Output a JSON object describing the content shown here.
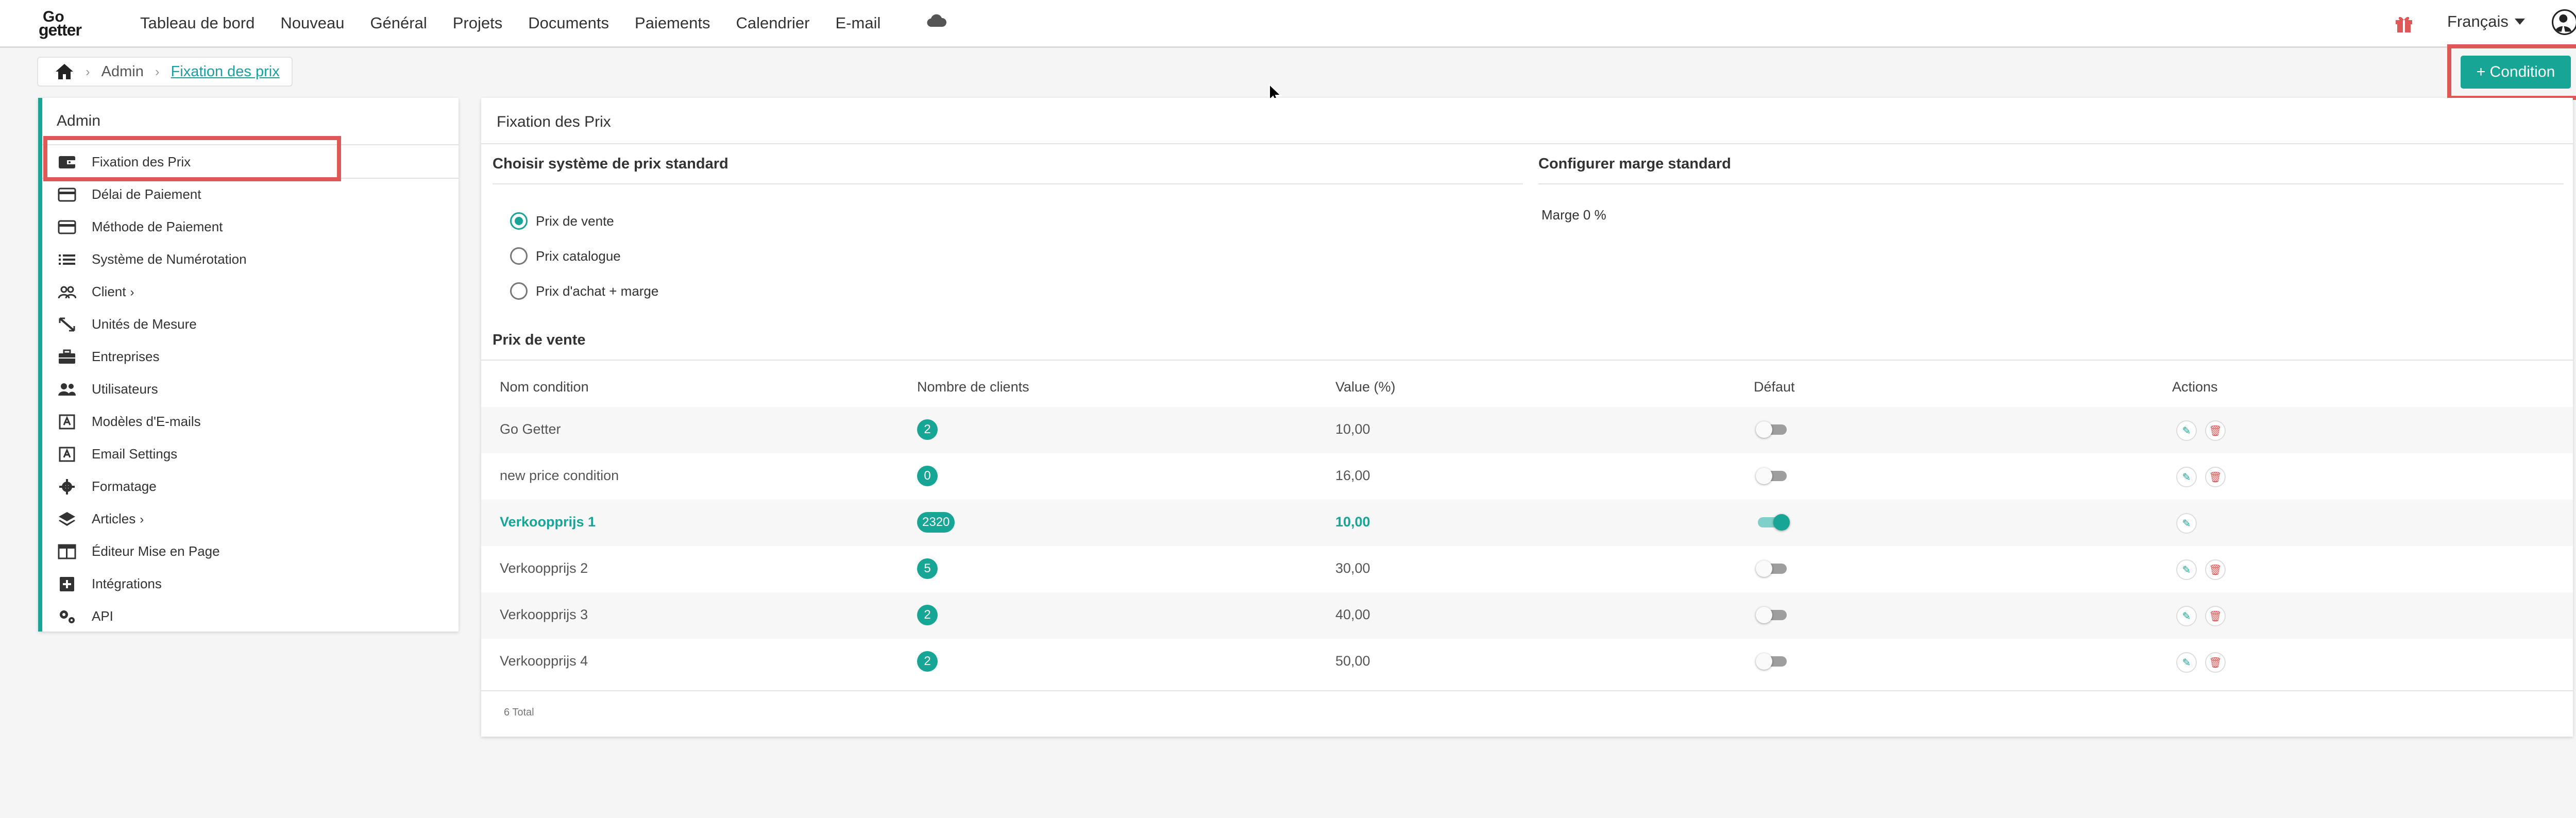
{
  "header": {
    "logo_top": "Go",
    "logo_bottom": "getter",
    "nav": [
      "Tableau de bord",
      "Nouveau",
      "Général",
      "Projets",
      "Documents",
      "Paiements",
      "Calendrier",
      "E-mail"
    ],
    "language": "Français",
    "icons": [
      "cloud-icon",
      "gift-icon",
      "avatar-icon"
    ]
  },
  "breadcrumb": {
    "home_icon": "home-icon",
    "items": [
      "Admin",
      "Fixation des prix"
    ]
  },
  "actions": {
    "condition_button": "+ Condition"
  },
  "sidebar": {
    "title": "Admin",
    "items": [
      {
        "label": "Fixation des Prix",
        "icon": "wallet-icon"
      },
      {
        "label": "Délai de Paiement",
        "icon": "card-icon"
      },
      {
        "label": "Méthode de Paiement",
        "icon": "card-icon"
      },
      {
        "label": "Système de Numérotation",
        "icon": "list-icon"
      },
      {
        "label": "Client",
        "icon": "people-icon",
        "chevron": "›"
      },
      {
        "label": "Unités de Mesure",
        "icon": "ruler-icon"
      },
      {
        "label": "Entreprises",
        "icon": "briefcase-icon"
      },
      {
        "label": "Utilisateurs",
        "icon": "users-icon"
      },
      {
        "label": "Modèles d'E-mails",
        "icon": "template-icon"
      },
      {
        "label": "Email Settings",
        "icon": "template-icon"
      },
      {
        "label": "Formatage",
        "icon": "gear-icon"
      },
      {
        "label": "Articles",
        "icon": "layers-icon",
        "chevron": "›"
      },
      {
        "label": "Éditeur Mise en Page",
        "icon": "layout-icon"
      },
      {
        "label": "Intégrations",
        "icon": "plus-box-icon"
      },
      {
        "label": "API",
        "icon": "gears-icon"
      }
    ]
  },
  "main": {
    "title": "Fixation des Prix",
    "price_system_title": "Choisir système de prix standard",
    "margin_title": "Configurer marge standard",
    "radio_options": [
      "Prix de vente",
      "Prix catalogue",
      "Prix d'achat + marge"
    ],
    "selected_option": "Prix de vente",
    "margin_text": "Marge 0 %",
    "table_title": "Prix de vente",
    "columns": [
      "Nom condition",
      "Nombre de clients",
      "Value (%)",
      "Défaut",
      "Actions"
    ],
    "rows": [
      {
        "name": "Go Getter",
        "clients": "2",
        "value": "10,00",
        "default": false
      },
      {
        "name": "new price condition",
        "clients": "0",
        "value": "16,00",
        "default": false
      },
      {
        "name": "Verkoopprijs 1",
        "clients": "2320",
        "value": "10,00",
        "default": true
      },
      {
        "name": "Verkoopprijs 2",
        "clients": "5",
        "value": "30,00",
        "default": false
      },
      {
        "name": "Verkoopprijs 3",
        "clients": "2",
        "value": "40,00",
        "default": false
      },
      {
        "name": "Verkoopprijs 4",
        "clients": "2",
        "value": "50,00",
        "default": false
      }
    ],
    "total": "6 Total"
  },
  "colors": {
    "accent": "#17a595",
    "highlight": "#e05757",
    "delete": "#e05757"
  }
}
